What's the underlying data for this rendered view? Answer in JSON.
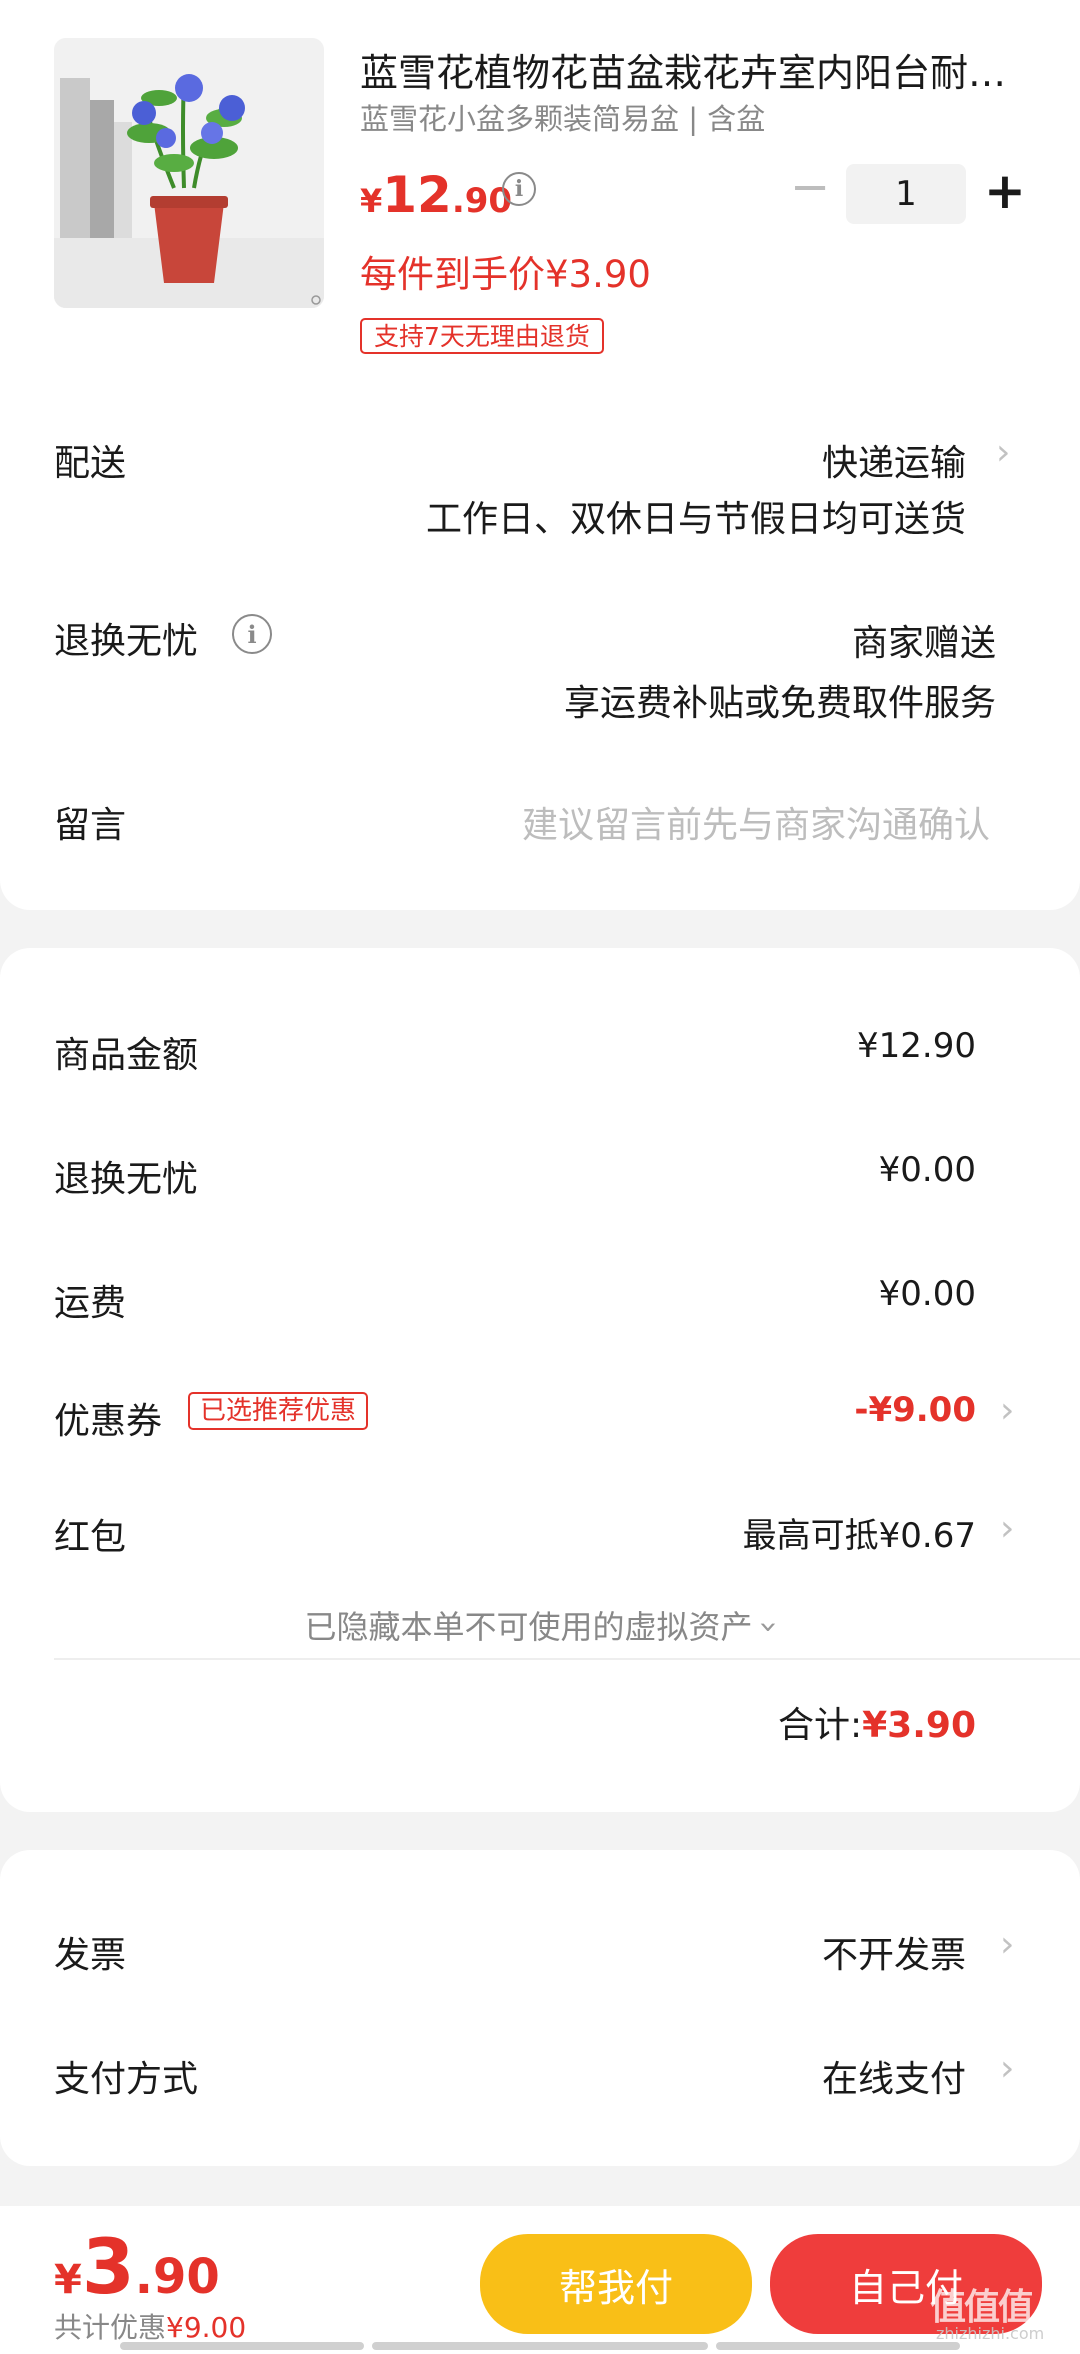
{
  "product": {
    "title": "蓝雪花植物花苗盆栽花卉室内阳台耐…",
    "spec": "蓝雪花小盆多颗装简易盆 | 含盆",
    "price_currency": "¥",
    "price_integer": "12",
    "price_decimal": ".90",
    "deal_price": "每件到手价¥3.90",
    "return_tag": "支持7天无理由退货",
    "quantity": "1",
    "minus_label": "−",
    "plus_label": "+"
  },
  "delivery": {
    "label": "配送",
    "method": "快递运输",
    "note": "工作日、双休日与节假日均可送货"
  },
  "worry_free": {
    "label": "退换无忧",
    "value": "商家赠送",
    "note": "享运费补贴或免费取件服务"
  },
  "message": {
    "label": "留言",
    "placeholder": "建议留言前先与商家沟通确认"
  },
  "summary": {
    "goods_label": "商品金额",
    "goods_value": "¥12.90",
    "worry_label": "退换无忧",
    "worry_value": "¥0.00",
    "shipping_label": "运费",
    "shipping_value": "¥0.00",
    "coupon_label": "优惠券",
    "coupon_tag": "已选推荐优惠",
    "coupon_value": "-¥9.00",
    "redpacket_label": "红包",
    "redpacket_value": "最高可抵¥0.67",
    "hidden_assets": "已隐藏本单不可使用的虚拟资产",
    "total_label": "合计:",
    "total_value": "¥3.90"
  },
  "invoice": {
    "label": "发票",
    "value": "不开发票"
  },
  "payment": {
    "label": "支付方式",
    "value": "在线支付"
  },
  "bottom": {
    "currency": "¥",
    "total_integer": "3",
    "total_decimal": ".90",
    "discount_prefix": "共计优惠",
    "discount_value": "¥9.00",
    "help_pay": "帮我付",
    "self_pay": "自己付",
    "watermark": "值值值",
    "watermark_url": "zhizhizhi.com"
  },
  "colors": {
    "accent_red": "#e4322a",
    "help_button": "#f9bf17",
    "self_button": "#ef3d3c"
  }
}
